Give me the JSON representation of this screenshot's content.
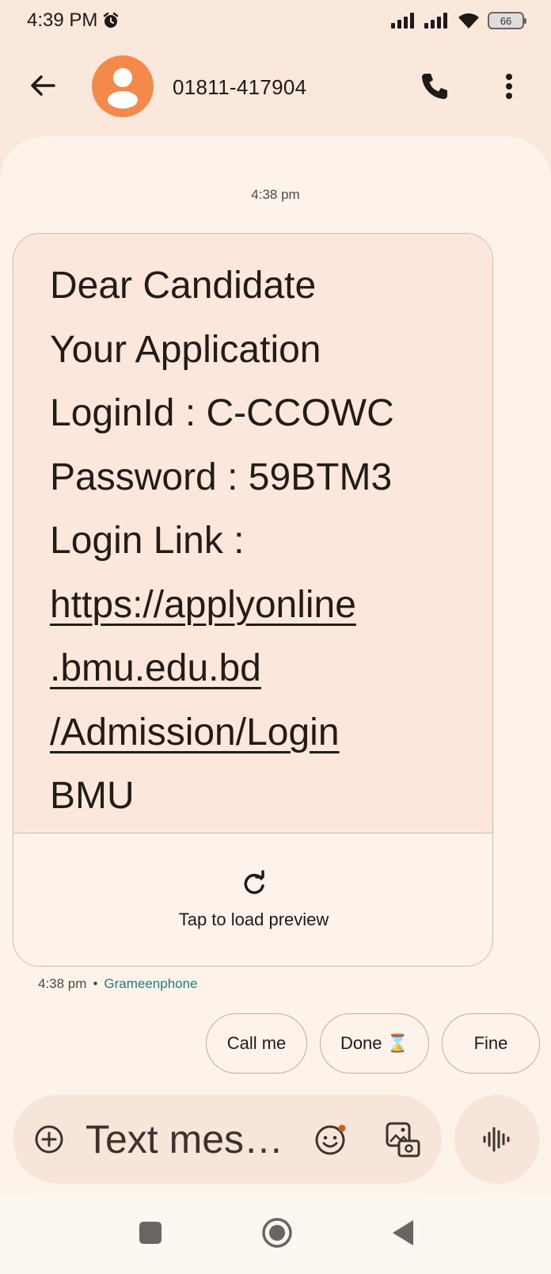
{
  "status_bar": {
    "time": "4:39 PM",
    "battery": "66",
    "icons": [
      "alarm-icon",
      "signal-icon",
      "signal-icon",
      "wifi-icon",
      "battery-icon"
    ]
  },
  "header": {
    "contact": "01811-417904",
    "icons": [
      "back-arrow-icon",
      "person-icon",
      "phone-icon",
      "more-vert-icon"
    ]
  },
  "conversation": {
    "timestamp": "4:38 pm",
    "message": {
      "lines": [
        "Dear Candidate",
        "Your Application",
        "LoginId : C-CCOWC",
        "Password : 59BTM3",
        "Login Link :"
      ],
      "link_lines": [
        "https://applyonline",
        ".bmu.edu.bd",
        "/Admission/Login"
      ],
      "signature": "BMU"
    },
    "preview_label": "Tap to load preview",
    "meta_time": "4:38 pm",
    "meta_separator": "•",
    "meta_carrier": "Grameenphone"
  },
  "smart_replies": [
    "Call me",
    "Done ⌛",
    "Fine"
  ],
  "composer": {
    "placeholder": "Text mes…",
    "icons": [
      "add-circle-icon",
      "emoji-icon",
      "gallery-icon",
      "voice-waveform-icon"
    ]
  },
  "nav_bar": {
    "icons": [
      "recents-square-icon",
      "home-circle-icon",
      "back-triangle-icon"
    ]
  },
  "colors": {
    "background": "#fae8dd",
    "panel": "#fdf3ea",
    "bubble": "#fbe7dc",
    "avatar": "#f3894a",
    "carrier_link": "#2b7a78"
  }
}
